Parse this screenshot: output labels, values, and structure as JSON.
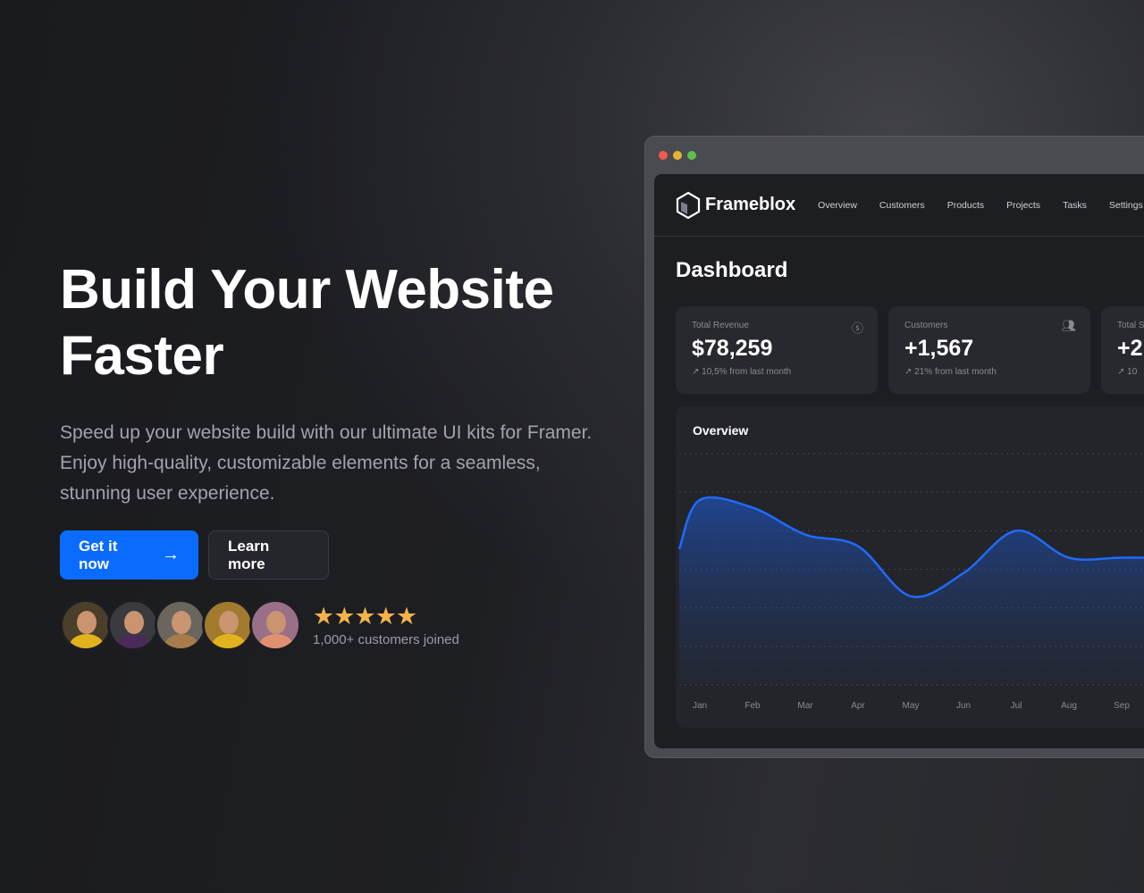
{
  "hero": {
    "title_line1": "Build Your Website",
    "title_line2": "Faster",
    "subtitle": "Speed up your website build with our ultimate UI kits for Framer. Enjoy high-quality, customizable elements for a seamless, stunning user experience.",
    "primary_button": "Get it now",
    "secondary_button": "Learn more",
    "rating": 5,
    "stars": "★★★★★",
    "customers_text": "1,000+ customers joined",
    "accent": "#0a6cff",
    "star_color": "#f3b24a"
  },
  "dashboard": {
    "brand": "Frameblox",
    "nav": [
      "Overview",
      "Customers",
      "Products",
      "Projects",
      "Tasks",
      "Settings"
    ],
    "title": "Dashboard",
    "cards": [
      {
        "label": "Total Revenue",
        "value": "$78,259",
        "change": "10,5% from last month",
        "icon": "dollar-icon"
      },
      {
        "label": "Customers",
        "value": "+1,567",
        "change": "21% from last month",
        "icon": "users-icon"
      },
      {
        "label": "Total S",
        "value": "+2",
        "change": "10",
        "icon": "trend-icon"
      }
    ],
    "overview_title": "Overview"
  },
  "chart_data": {
    "type": "area",
    "categories": [
      "Jan",
      "Feb",
      "Mar",
      "Apr",
      "May",
      "Jun",
      "Jul",
      "Aug",
      "Sep"
    ],
    "values": [
      4.8,
      4.6,
      3.9,
      3.6,
      2.3,
      2.9,
      4.0,
      3.3,
      3.3
    ],
    "ylim": [
      0,
      6
    ],
    "grid": true,
    "line_color": "#1f6bff"
  }
}
